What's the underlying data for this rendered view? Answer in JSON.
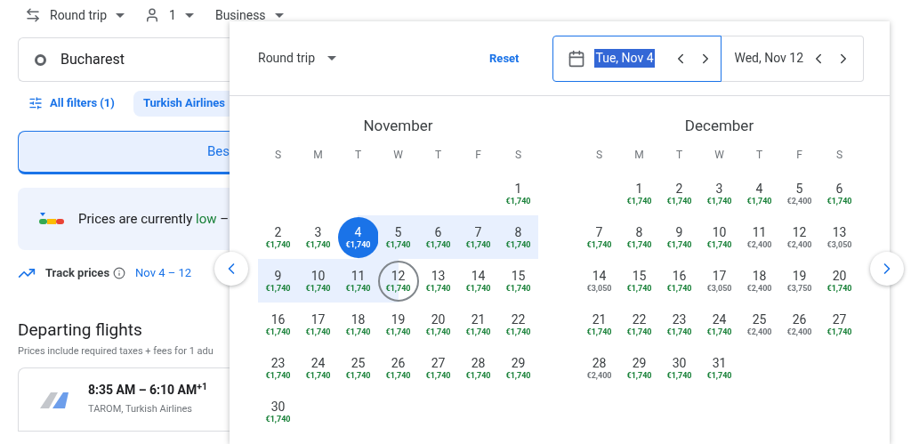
{
  "top_bar": {
    "trip_type": "Round trip",
    "passengers": "1",
    "cabin": "Business"
  },
  "search": {
    "origin": "Bucharest"
  },
  "filters": {
    "all_filters": "All filters (1)",
    "chips": [
      {
        "label": "Turkish Airlines",
        "selected": true
      }
    ]
  },
  "sort_tabs": [
    {
      "label": "Bes",
      "selected": true
    }
  ],
  "insight": {
    "prefix": "Prices are currently",
    "level_word": "low",
    "suffix": "–"
  },
  "track": {
    "label": "Track prices",
    "dates": "Nov 4 – 12"
  },
  "departing": {
    "title": "Departing flights",
    "subtitle": "Prices include required taxes + fees for 1 adu"
  },
  "flights": [
    {
      "times": "8:35 AM – 6:10 AM$^{+1}$",
      "airlines": "TAROM, Turkish Airlines"
    }
  ],
  "date_picker": {
    "trip_type": "Round trip",
    "reset": "Reset",
    "fields": [
      {
        "value": "Tue, Nov 4",
        "selected": true
      },
      {
        "value": "Wed, Nov 12",
        "selected": false
      }
    ],
    "months": [
      {
        "name": "November",
        "weekdays": [
          "S",
          "M",
          "T",
          "W",
          "T",
          "F",
          "S"
        ],
        "weeks": [
          [
            {
              "kind": "blank"
            },
            {
              "kind": "blank"
            },
            {
              "kind": "blank"
            },
            {
              "kind": "blank"
            },
            {
              "kind": "blank"
            },
            {
              "kind": "blank"
            },
            {
              "kind": "day",
              "d": "1",
              "price": "€1,740",
              "low": true,
              "selected": false,
              "end": false,
              "in_range": false
            }
          ],
          [
            {
              "kind": "day",
              "d": "2",
              "price": "€1,740",
              "low": true,
              "selected": false,
              "end": false,
              "in_range": false
            },
            {
              "kind": "day",
              "d": "3",
              "price": "€1,740",
              "low": true,
              "selected": false,
              "end": false,
              "in_range": false
            },
            {
              "kind": "day",
              "d": "4",
              "price": "€1,740",
              "low": true,
              "selected": true,
              "end": false,
              "in_range": true
            },
            {
              "kind": "day",
              "d": "5",
              "price": "€1,740",
              "low": true,
              "selected": false,
              "end": false,
              "in_range": true
            },
            {
              "kind": "day",
              "d": "6",
              "price": "€1,740",
              "low": true,
              "selected": false,
              "end": false,
              "in_range": true
            },
            {
              "kind": "day",
              "d": "7",
              "price": "€1,740",
              "low": true,
              "selected": false,
              "end": false,
              "in_range": true
            },
            {
              "kind": "day",
              "d": "8",
              "price": "€1,740",
              "low": true,
              "selected": false,
              "end": false,
              "in_range": true
            }
          ],
          [
            {
              "kind": "day",
              "d": "9",
              "price": "€1,740",
              "low": true,
              "selected": false,
              "end": false,
              "in_range": true
            },
            {
              "kind": "day",
              "d": "10",
              "price": "€1,740",
              "low": true,
              "selected": false,
              "end": false,
              "in_range": true
            },
            {
              "kind": "day",
              "d": "11",
              "price": "€1,740",
              "low": true,
              "selected": false,
              "end": false,
              "in_range": true
            },
            {
              "kind": "day",
              "d": "12",
              "price": "€1,740",
              "low": true,
              "selected": false,
              "end": true,
              "in_range": true
            },
            {
              "kind": "day",
              "d": "13",
              "price": "€1,740",
              "low": true,
              "selected": false,
              "end": false,
              "in_range": false
            },
            {
              "kind": "day",
              "d": "14",
              "price": "€1,740",
              "low": true,
              "selected": false,
              "end": false,
              "in_range": false
            },
            {
              "kind": "day",
              "d": "15",
              "price": "€1,740",
              "low": true,
              "selected": false,
              "end": false,
              "in_range": false
            }
          ],
          [
            {
              "kind": "day",
              "d": "16",
              "price": "€1,740",
              "low": true,
              "selected": false,
              "end": false,
              "in_range": false
            },
            {
              "kind": "day",
              "d": "17",
              "price": "€1,740",
              "low": true,
              "selected": false,
              "end": false,
              "in_range": false
            },
            {
              "kind": "day",
              "d": "18",
              "price": "€1,740",
              "low": true,
              "selected": false,
              "end": false,
              "in_range": false
            },
            {
              "kind": "day",
              "d": "19",
              "price": "€1,740",
              "low": true,
              "selected": false,
              "end": false,
              "in_range": false
            },
            {
              "kind": "day",
              "d": "20",
              "price": "€1,740",
              "low": true,
              "selected": false,
              "end": false,
              "in_range": false
            },
            {
              "kind": "day",
              "d": "21",
              "price": "€1,740",
              "low": true,
              "selected": false,
              "end": false,
              "in_range": false
            },
            {
              "kind": "day",
              "d": "22",
              "price": "€1,740",
              "low": true,
              "selected": false,
              "end": false,
              "in_range": false
            }
          ],
          [
            {
              "kind": "day",
              "d": "23",
              "price": "€1,740",
              "low": true,
              "selected": false,
              "end": false,
              "in_range": false
            },
            {
              "kind": "day",
              "d": "24",
              "price": "€1,740",
              "low": true,
              "selected": false,
              "end": false,
              "in_range": false
            },
            {
              "kind": "day",
              "d": "25",
              "price": "€1,740",
              "low": true,
              "selected": false,
              "end": false,
              "in_range": false
            },
            {
              "kind": "day",
              "d": "26",
              "price": "€1,740",
              "low": true,
              "selected": false,
              "end": false,
              "in_range": false
            },
            {
              "kind": "day",
              "d": "27",
              "price": "€1,740",
              "low": true,
              "selected": false,
              "end": false,
              "in_range": false
            },
            {
              "kind": "day",
              "d": "28",
              "price": "€1,740",
              "low": true,
              "selected": false,
              "end": false,
              "in_range": false
            },
            {
              "kind": "day",
              "d": "29",
              "price": "€1,740",
              "low": true,
              "selected": false,
              "end": false,
              "in_range": false
            }
          ],
          [
            {
              "kind": "day",
              "d": "30",
              "price": "€1,740",
              "low": true,
              "selected": false,
              "end": false,
              "in_range": false
            }
          ]
        ]
      },
      {
        "name": "December",
        "weekdays": [
          "S",
          "M",
          "T",
          "W",
          "T",
          "F",
          "S"
        ],
        "weeks": [
          [
            {
              "kind": "blank"
            },
            {
              "kind": "day",
              "d": "1",
              "price": "€1,740",
              "low": true,
              "selected": false,
              "end": false,
              "in_range": false
            },
            {
              "kind": "day",
              "d": "2",
              "price": "€1,740",
              "low": true,
              "selected": false,
              "end": false,
              "in_range": false
            },
            {
              "kind": "day",
              "d": "3",
              "price": "€1,740",
              "low": true,
              "selected": false,
              "end": false,
              "in_range": false
            },
            {
              "kind": "day",
              "d": "4",
              "price": "€1,740",
              "low": true,
              "selected": false,
              "end": false,
              "in_range": false
            },
            {
              "kind": "day",
              "d": "5",
              "price": "€2,400",
              "low": false,
              "selected": false,
              "end": false,
              "in_range": false
            },
            {
              "kind": "day",
              "d": "6",
              "price": "€1,740",
              "low": true,
              "selected": false,
              "end": false,
              "in_range": false
            }
          ],
          [
            {
              "kind": "day",
              "d": "7",
              "price": "€1,740",
              "low": true,
              "selected": false,
              "end": false,
              "in_range": false
            },
            {
              "kind": "day",
              "d": "8",
              "price": "€1,740",
              "low": true,
              "selected": false,
              "end": false,
              "in_range": false
            },
            {
              "kind": "day",
              "d": "9",
              "price": "€1,740",
              "low": true,
              "selected": false,
              "end": false,
              "in_range": false
            },
            {
              "kind": "day",
              "d": "10",
              "price": "€1,740",
              "low": true,
              "selected": false,
              "end": false,
              "in_range": false
            },
            {
              "kind": "day",
              "d": "11",
              "price": "€2,400",
              "low": false,
              "selected": false,
              "end": false,
              "in_range": false
            },
            {
              "kind": "day",
              "d": "12",
              "price": "€2,400",
              "low": false,
              "selected": false,
              "end": false,
              "in_range": false
            },
            {
              "kind": "day",
              "d": "13",
              "price": "€3,050",
              "low": false,
              "selected": false,
              "end": false,
              "in_range": false
            }
          ],
          [
            {
              "kind": "day",
              "d": "14",
              "price": "€3,050",
              "low": false,
              "selected": false,
              "end": false,
              "in_range": false
            },
            {
              "kind": "day",
              "d": "15",
              "price": "€1,740",
              "low": true,
              "selected": false,
              "end": false,
              "in_range": false
            },
            {
              "kind": "day",
              "d": "16",
              "price": "€1,740",
              "low": true,
              "selected": false,
              "end": false,
              "in_range": false
            },
            {
              "kind": "day",
              "d": "17",
              "price": "€3,050",
              "low": false,
              "selected": false,
              "end": false,
              "in_range": false
            },
            {
              "kind": "day",
              "d": "18",
              "price": "€2,400",
              "low": false,
              "selected": false,
              "end": false,
              "in_range": false
            },
            {
              "kind": "day",
              "d": "19",
              "price": "€3,750",
              "low": false,
              "selected": false,
              "end": false,
              "in_range": false
            },
            {
              "kind": "day",
              "d": "20",
              "price": "€1,740",
              "low": true,
              "selected": false,
              "end": false,
              "in_range": false
            }
          ],
          [
            {
              "kind": "day",
              "d": "21",
              "price": "€1,740",
              "low": true,
              "selected": false,
              "end": false,
              "in_range": false
            },
            {
              "kind": "day",
              "d": "22",
              "price": "€1,740",
              "low": true,
              "selected": false,
              "end": false,
              "in_range": false
            },
            {
              "kind": "day",
              "d": "23",
              "price": "€1,740",
              "low": true,
              "selected": false,
              "end": false,
              "in_range": false
            },
            {
              "kind": "day",
              "d": "24",
              "price": "€1,740",
              "low": true,
              "selected": false,
              "end": false,
              "in_range": false
            },
            {
              "kind": "day",
              "d": "25",
              "price": "€2,400",
              "low": false,
              "selected": false,
              "end": false,
              "in_range": false
            },
            {
              "kind": "day",
              "d": "26",
              "price": "€2,400",
              "low": false,
              "selected": false,
              "end": false,
              "in_range": false
            },
            {
              "kind": "day",
              "d": "27",
              "price": "€1,740",
              "low": true,
              "selected": false,
              "end": false,
              "in_range": false
            }
          ],
          [
            {
              "kind": "day",
              "d": "28",
              "price": "€2,400",
              "low": false,
              "selected": false,
              "end": false,
              "in_range": false
            },
            {
              "kind": "day",
              "d": "29",
              "price": "€1,740",
              "low": true,
              "selected": false,
              "end": false,
              "in_range": false
            },
            {
              "kind": "day",
              "d": "30",
              "price": "€1,740",
              "low": true,
              "selected": false,
              "end": false,
              "in_range": false
            },
            {
              "kind": "day",
              "d": "31",
              "price": "€1,740",
              "low": true,
              "selected": false,
              "end": false,
              "in_range": false
            }
          ]
        ]
      }
    ]
  }
}
